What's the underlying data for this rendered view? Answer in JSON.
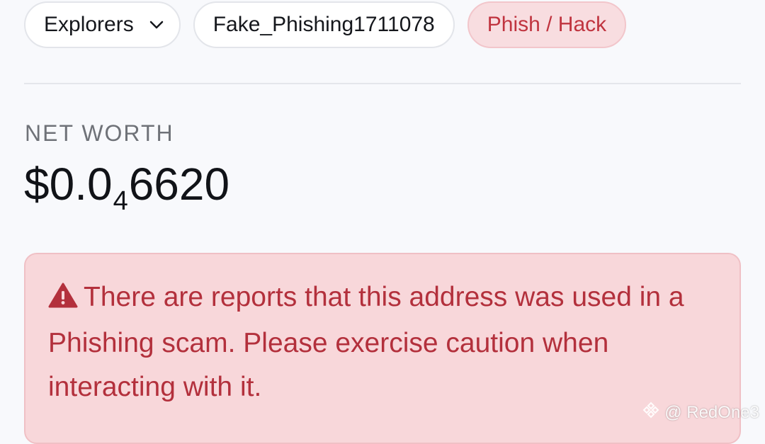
{
  "chips": {
    "explorers_label": "Explorers",
    "address_label": "Fake_Phishing1711078",
    "tag_label": "Phish / Hack"
  },
  "net_worth": {
    "label": "NET WORTH",
    "value_prefix": "$0.0",
    "value_subscript": "4",
    "value_suffix": "6620"
  },
  "alert": {
    "message": "There are reports that this address was used in a Phishing scam. Please exercise caution when interacting with it."
  },
  "watermark": {
    "text": "@ RedOne3"
  },
  "colors": {
    "danger": "#c0343f",
    "danger_bg": "#f8d7da"
  }
}
